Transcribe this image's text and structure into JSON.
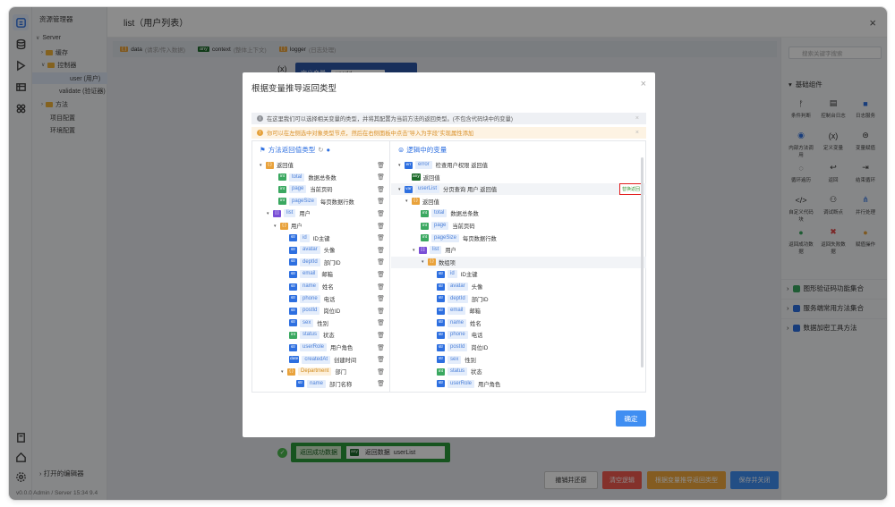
{
  "sidebar": {
    "title": "资源管理器",
    "server": "Server",
    "items": [
      "缓存",
      "控制器",
      "user (用户)",
      "validate (验证器)",
      "方法",
      "项目配置",
      "环境配置"
    ],
    "open_editors": "打开的编辑器",
    "status": "v0.0.0  Admin / Server",
    "status2": "15:34 9.4"
  },
  "tab": {
    "title": "list（用户列表）"
  },
  "context_bar": [
    {
      "type": "data",
      "desc": "(请求/传入数据)"
    },
    {
      "type": "context",
      "desc": "(整体上下文)"
    },
    {
      "type": "logger",
      "desc": "(日志处理)"
    }
  ],
  "node": {
    "fx": "(x)",
    "label": "定义变量",
    "value": "userId"
  },
  "bottom_node": {
    "label": "返回成功数据",
    "var_label": "返回数据",
    "var_value": "userList"
  },
  "palette": {
    "search_placeholder": "搜索关键字搜索",
    "section": "基础组件",
    "items": [
      "条件判断",
      "控制台日志",
      "日志服务",
      "内部方法调用",
      "定义变量",
      "变量赋值",
      "循环遍历",
      "返回",
      "结束循环",
      "自定义代码块",
      "调试断点",
      "并行处理",
      "返回成功数据",
      "返回失败数据",
      "赋值操作"
    ],
    "groups": [
      "图形验证码功能集合",
      "服务端常用方法集合",
      "数据加密工具方法"
    ]
  },
  "footer": {
    "btn1": "撤销并还原",
    "btn2": "清空逻辑",
    "btn3": "根据变量推导返回类型",
    "btn4": "保存并关闭"
  },
  "modal": {
    "title": "根据变量推导返回类型",
    "info": "在这里我们可以选择相关变量的类型，并将其配置为当前方法的返回类型。(不包含代码块中的变量)",
    "warn": "你可以在左侧选中对象类型节点，然后在右侧面板中点击\"导入为字段\"实现属性添加",
    "left_head": "方法返回值类型",
    "right_head": "逻辑中的变量",
    "ok": "确定",
    "import_btn": "替换返回",
    "left_rows": [
      {
        "tag": "{ }",
        "nm": "",
        "d": "返回值"
      },
      {
        "tag": "int",
        "nm": "total",
        "d": "数据总条数"
      },
      {
        "tag": "int",
        "nm": "page",
        "d": "当前页码"
      },
      {
        "tag": "int",
        "nm": "pageSize",
        "d": "每页数据行数"
      },
      {
        "tag": "[ ]",
        "nm": "list",
        "d": "用户"
      },
      {
        "tag": "{ }",
        "nm": "",
        "d": "用户"
      },
      {
        "tag": "str",
        "nm": "id",
        "d": "ID主键"
      },
      {
        "tag": "str",
        "nm": "avatar",
        "d": "头像"
      },
      {
        "tag": "str",
        "nm": "deptId",
        "d": "部门ID"
      },
      {
        "tag": "str",
        "nm": "email",
        "d": "邮箱"
      },
      {
        "tag": "str",
        "nm": "name",
        "d": "姓名"
      },
      {
        "tag": "str",
        "nm": "phone",
        "d": "电话"
      },
      {
        "tag": "str",
        "nm": "postId",
        "d": "岗位ID"
      },
      {
        "tag": "str",
        "nm": "sex",
        "d": "性别"
      },
      {
        "tag": "int",
        "nm": "status",
        "d": "状态"
      },
      {
        "tag": "str",
        "nm": "userRole",
        "d": "用户角色"
      },
      {
        "tag": "date",
        "nm": "createdAt",
        "d": "创建时间"
      },
      {
        "tag": "{ }",
        "nm": "Department",
        "d": "部门"
      },
      {
        "tag": "str",
        "nm": "name",
        "d": "部门名称"
      },
      {
        "tag": "{ }",
        "nm": "Position",
        "d": "岗位"
      }
    ],
    "right_rows": [
      {
        "tag": "err",
        "nm": "error",
        "d": "检查用户权限 返回值"
      },
      {
        "tag": "any",
        "nm": "",
        "d": "返回值"
      },
      {
        "tag": "var",
        "nm": "userList",
        "d": "分页查询 用户 返回值"
      },
      {
        "tag": "{ }",
        "nm": "",
        "d": "返回值"
      },
      {
        "tag": "int",
        "nm": "total",
        "d": "数据总条数"
      },
      {
        "tag": "int",
        "nm": "page",
        "d": "当前页码"
      },
      {
        "tag": "int",
        "nm": "pageSize",
        "d": "每页数据行数"
      },
      {
        "tag": "[ ]",
        "nm": "list",
        "d": "用户"
      },
      {
        "tag": "{ }",
        "nm": "",
        "d": "数组项"
      },
      {
        "tag": "str",
        "nm": "id",
        "d": "ID主键"
      },
      {
        "tag": "str",
        "nm": "avatar",
        "d": "头像"
      },
      {
        "tag": "str",
        "nm": "deptId",
        "d": "部门ID"
      },
      {
        "tag": "str",
        "nm": "email",
        "d": "邮箱"
      },
      {
        "tag": "str",
        "nm": "name",
        "d": "姓名"
      },
      {
        "tag": "str",
        "nm": "phone",
        "d": "电话"
      },
      {
        "tag": "str",
        "nm": "postId",
        "d": "岗位ID"
      },
      {
        "tag": "str",
        "nm": "sex",
        "d": "性别"
      },
      {
        "tag": "int",
        "nm": "status",
        "d": "状态"
      },
      {
        "tag": "str",
        "nm": "userRole",
        "d": "用户角色"
      },
      {
        "tag": "date",
        "nm": "createdAt",
        "d": "创建时间"
      }
    ]
  }
}
